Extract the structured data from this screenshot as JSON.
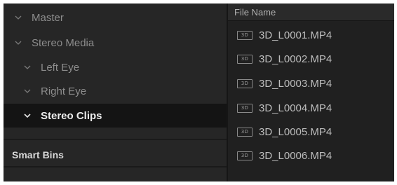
{
  "bins": {
    "items": [
      {
        "label": "Master"
      },
      {
        "label": "Stereo Media"
      },
      {
        "label": "Left Eye"
      },
      {
        "label": "Right Eye"
      },
      {
        "label": "Stereo Clips",
        "selected": true
      }
    ],
    "smart_bins_label": "Smart Bins"
  },
  "files": {
    "column_header": "File Name",
    "badge_text": "3D",
    "items": [
      {
        "name": "3D_L0001.MP4"
      },
      {
        "name": "3D_L0002.MP4"
      },
      {
        "name": "3D_L0003.MP4"
      },
      {
        "name": "3D_L0004.MP4"
      },
      {
        "name": "3D_L0005.MP4"
      },
      {
        "name": "3D_L0006.MP4"
      }
    ]
  },
  "colors": {
    "panel_bg": "#262626",
    "selected_bg": "#141414",
    "text_dim": "#8d8d8d",
    "text_bright": "#ececec"
  },
  "icons": {
    "expand": "chevron-down-icon",
    "stereo_badge": "3d-badge-icon"
  }
}
